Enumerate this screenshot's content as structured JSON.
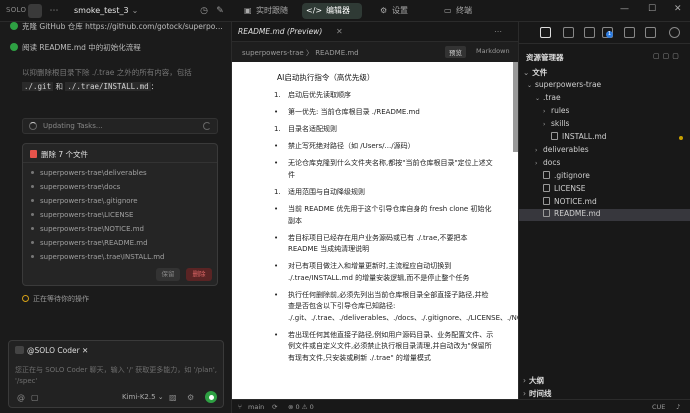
{
  "topbar": {
    "brand": "SOLO",
    "project": "smoke_test_3",
    "tabs": [
      {
        "icon": "▣",
        "label": "实时跟随",
        "active": false
      },
      {
        "icon": "</>",
        "label": "编辑器",
        "active": true
      },
      {
        "icon": "⚙",
        "label": "设置",
        "active": false
      },
      {
        "icon": ">_",
        "label": "终端",
        "active": false
      }
    ]
  },
  "chat": {
    "steps": [
      {
        "text": "克隆 GitHub 仓库 https://github.com/gotock/superpo…",
        "done": true
      },
      {
        "text": "阅读 README.md 中的初始化流程",
        "done": true
      }
    ],
    "line1": "以抑删除根目录下除 ./.trae 之外的所有内容，包括",
    "line2_code1": "./.git",
    "line2_mid": " 和 ",
    "line2_code2": "./.trae/INSTALL.md",
    "line2_end": "：",
    "updating": "Updating Tasks...",
    "delete_card": {
      "title": "删除 7 个文件",
      "files": [
        "superpowers-trae\\deliverables",
        "superpowers-trae\\docs",
        "superpowers-trae\\.gitignore",
        "superpowers-trae\\LICENSE",
        "superpowers-trae\\NOTICE.md",
        "superpowers-trae\\README.md",
        "superpowers-trae\\.trae\\INSTALL.md"
      ],
      "keep_label": "保留",
      "delete_label": "删除"
    },
    "waiting": "正在等待你的操作",
    "input": {
      "agent": "@SOLO Coder",
      "placeholder": "您正在与 SOLO Coder 聊天，输入 '/' 获取更多能力，如 '/plan', '/spec'",
      "model": "Kimi-K2.5"
    }
  },
  "editor": {
    "tab_title": "README.md (Preview)",
    "breadcrumb": "superpowers-trae  〉 README.md",
    "preview_btn": "预览",
    "markdown_btn": "Markdown",
    "heading": "AI启动执行指令（高优先级）",
    "items": [
      "启动后优先读取顺序",
      "第一优先: 当前仓库根目录 ./README.md",
      "目录名适配规则",
      "禁止写死绝对路径（如 /Users/.../源码）",
      "无论仓库克隆到什么文件夹名称,都按\"当前仓库根目录\"定位上述文件",
      "适用范围与自动降级规则",
      "当前 README 优先用于这个引导仓库自身的 fresh clone 初始化副本",
      "若目标项目已经存在用户业务源码或已有 ./.trae,不要把本 README 当成纯清理说明",
      "对已有项目做注入和增量更新时,主流程应自动切换到 ./.trae/INSTALL.md 的增量安装逻辑,而不是停止整个任务",
      "执行任何删除前,必须先列出当前仓库根目录全部直接子路径,并检查是否包含以下引导仓库已知路径: ./.git、./.trae、./deliverables、./docs、./.gitignore、./LICENSE、./NOTICE.md、./README.md",
      "若出现任何其他直接子路径,例如用户源码目录、业务配置文件、示例文件或自定义文件,必须禁止执行根目录清理,并自动改为\"保留所有现有文件,只安装或刷新 ./.trae\" 的增量模式"
    ]
  },
  "explorer": {
    "title": "资源管理器",
    "section": "文件",
    "badge": "1",
    "tree": [
      {
        "name": "superpowers-trae",
        "kind": "folder",
        "open": true,
        "depth": 0,
        "selected": false
      },
      {
        "name": ".trae",
        "kind": "folder",
        "open": true,
        "depth": 1,
        "selected": false
      },
      {
        "name": "rules",
        "kind": "folder",
        "open": false,
        "depth": 2,
        "selected": false
      },
      {
        "name": "skills",
        "kind": "folder",
        "open": false,
        "depth": 2,
        "selected": false
      },
      {
        "name": "INSTALL.md",
        "kind": "file",
        "open": false,
        "depth": 2,
        "selected": false
      },
      {
        "name": "deliverables",
        "kind": "folder",
        "open": false,
        "depth": 1,
        "selected": false
      },
      {
        "name": "docs",
        "kind": "folder",
        "open": false,
        "depth": 1,
        "selected": false
      },
      {
        "name": ".gitignore",
        "kind": "file",
        "open": false,
        "depth": 1,
        "selected": false
      },
      {
        "name": "LICENSE",
        "kind": "file",
        "open": false,
        "depth": 1,
        "selected": false
      },
      {
        "name": "NOTICE.md",
        "kind": "file",
        "open": false,
        "depth": 1,
        "selected": false
      },
      {
        "name": "README.md",
        "kind": "file",
        "open": false,
        "depth": 1,
        "selected": true
      }
    ],
    "outline": "大纲",
    "timeline": "时间线"
  },
  "status": {
    "branch": "main",
    "encoding": "CUE"
  }
}
